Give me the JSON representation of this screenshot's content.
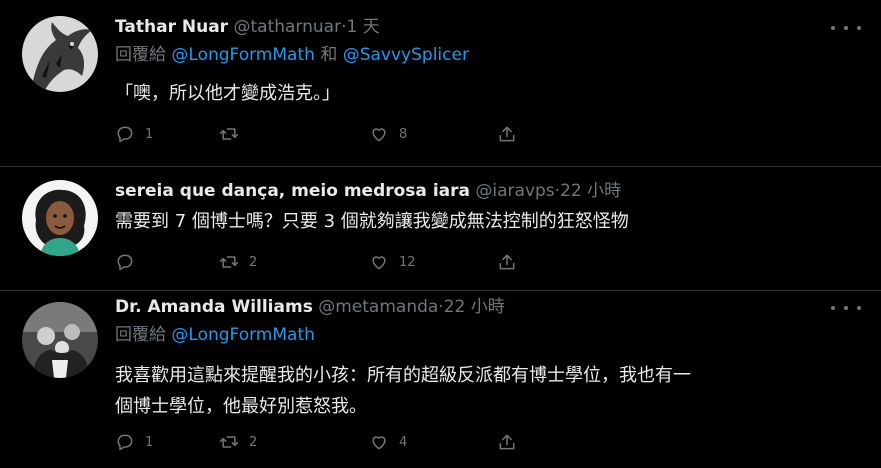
{
  "tweets": [
    {
      "name": "Tathar Nuar",
      "handle": "@tatharnuar",
      "dot": "·",
      "time": "1 天",
      "replying_prefix": "回覆給",
      "mention1": "@LongFormMath",
      "joiner": "和",
      "mention2": "@SavvySplicer",
      "text": "「噢，所以他才變成浩克。」",
      "replies": "1",
      "retweets": "",
      "likes": "8",
      "avatar_icon": "dragon-avatar"
    },
    {
      "name": "sereia que dança, meio medrosa iara",
      "handle": "@iaravps",
      "dot": "·",
      "time": "22 小時",
      "text": "需要到 7 個博士嗎？只要 3 個就夠讓我變成無法控制的狂怒怪物",
      "replies": "",
      "retweets": "2",
      "likes": "12",
      "avatar_icon": "illustrated-woman-avatar"
    },
    {
      "name": "Dr. Amanda Williams",
      "handle": "@metamanda",
      "dot": "·",
      "time": "22 小時",
      "replying_prefix": "回覆給",
      "mention1": "@LongFormMath",
      "text_line1": "我喜歡用這點來提醒我的小孩：所有的超級反派都有博士學位，我也有一",
      "text_line2": "個博士學位，他最好別惹怒我。",
      "replies": "1",
      "retweets": "2",
      "likes": "4",
      "avatar_icon": "group-photo-avatar"
    }
  ],
  "colors": {
    "background": "#000000",
    "text": "#e7e9ea",
    "muted": "#71767b",
    "link": "#1d9bf0",
    "divider": "#2f3336"
  }
}
